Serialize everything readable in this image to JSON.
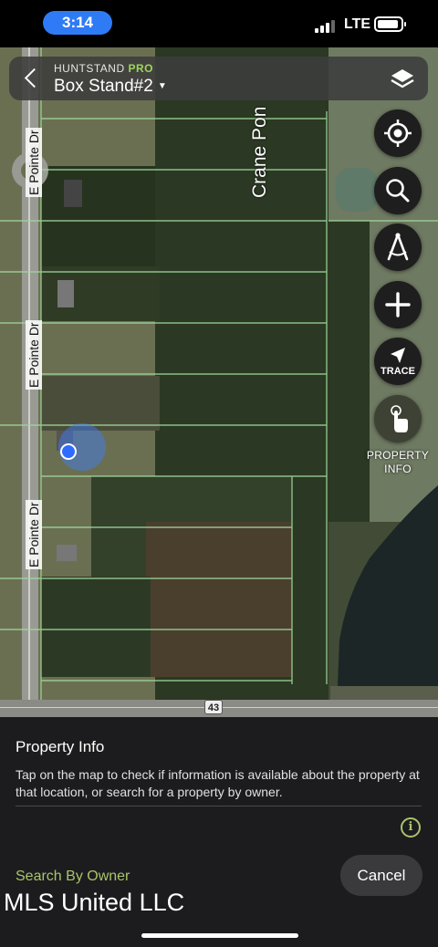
{
  "status_bar": {
    "time": "3:14",
    "network": "LTE",
    "time_pill_color": "#2f7bf6"
  },
  "header": {
    "brand": "HUNTSTAND",
    "brand_tier": "PRO",
    "stand_name": "Box Stand#2",
    "back_icon": "chevron-left-icon",
    "layers_icon": "layers-icon"
  },
  "map": {
    "road_labels": [
      "E Pointe Dr",
      "E Pointe Dr",
      "E Pointe Dr"
    ],
    "crane_label": "Crane Pon",
    "highway_badge": "43",
    "parcel_line_color": "#9fd89a"
  },
  "map_buttons": [
    {
      "icon": "crosshair-location-icon"
    },
    {
      "icon": "search-icon"
    },
    {
      "icon": "compass-icon"
    },
    {
      "icon": "plus-icon"
    },
    {
      "icon": "trace-arrow-icon",
      "label": "TRACE"
    },
    {
      "icon": "tap-hand-icon",
      "caption_line1": "PROPERTY",
      "caption_line2": "INFO"
    }
  ],
  "sheet": {
    "title": "Property Info",
    "description": "Tap on the map to check if information is available about the property at that location, or search for a property by owner.",
    "info_icon": "info-icon",
    "search_by_owner": "Search By Owner",
    "cancel": "Cancel",
    "owner_overlay": "MLS United LLC",
    "accent_color": "#a8c46c"
  }
}
